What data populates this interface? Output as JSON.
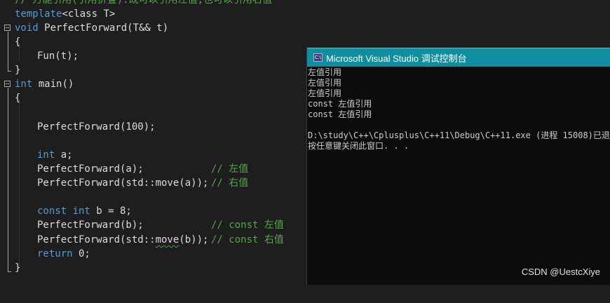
{
  "editor": {
    "lines": {
      "comment_top": "// 万能引用(引用折叠):既可以引用左值,也可以引用右值",
      "template_kw": "template",
      "template_rest": "<class T>",
      "void_kw": "void",
      "pf_decl": " PerfectForward(T&& t)",
      "open1": "{",
      "fun_call": "Fun(t);",
      "close1": "}",
      "int_kw": "int",
      "main_decl": " main()",
      "open2": "{",
      "pf100": "PerfectForward(100);",
      "int_a_kw": "int",
      "int_a_rest": " a;",
      "pfa": "PerfectForward(a);",
      "pfa_cm": "// 左值",
      "pfmove": "PerfectForward(std::move(a));",
      "pfmove_cm": "// 右值",
      "const_kw": "const int",
      "const_rest": " b = 8;",
      "pfb": "PerfectForward(b);",
      "pfb_cm": "// const 左值",
      "pfmoveb_a": "PerfectForward(std::",
      "pfmoveb_b": "move",
      "pfmoveb_c": "(b));",
      "pfmoveb_cm": "// const 右值",
      "return_kw": "return",
      "return_rest": " 0;",
      "close2": "}"
    }
  },
  "console": {
    "title": "Microsoft Visual Studio 调试控制台",
    "icon_text": "C:\\",
    "output": [
      "左值引用",
      "左值引用",
      "左值引用",
      "const 左值引用",
      "const 左值引用",
      "",
      "D:\\study\\C++\\Cplusplus\\C++11\\Debug\\C++11.exe (进程 15008)已退",
      "按任意键关闭此窗口. . ."
    ]
  },
  "watermark": "CSDN @UestcXiye"
}
